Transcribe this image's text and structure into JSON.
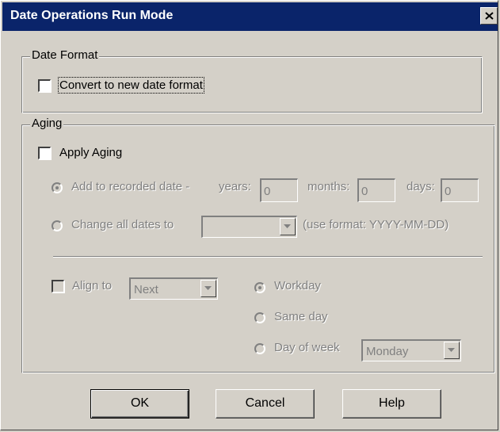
{
  "window": {
    "title": "Date Operations Run Mode"
  },
  "date_format": {
    "group_label": "Date Format",
    "convert_label": "Convert to new date format",
    "convert_checked": false
  },
  "aging": {
    "group_label": "Aging",
    "apply_label": "Apply Aging",
    "apply_checked": false,
    "add_label": "Add to recorded date -",
    "years_label": "years:",
    "years_value": "0",
    "months_label": "months:",
    "months_value": "0",
    "days_label": "days:",
    "days_value": "0",
    "change_label": "Change all dates to",
    "change_value": "",
    "format_hint": "(use format: YYYY-MM-DD)",
    "align_label": "Align to",
    "align_value": "Next",
    "workday_label": "Workday",
    "sameday_label": "Same day",
    "dayofweek_label": "Day of week",
    "dayofweek_value": "Monday"
  },
  "buttons": {
    "ok": "OK",
    "cancel": "Cancel",
    "help": "Help"
  }
}
